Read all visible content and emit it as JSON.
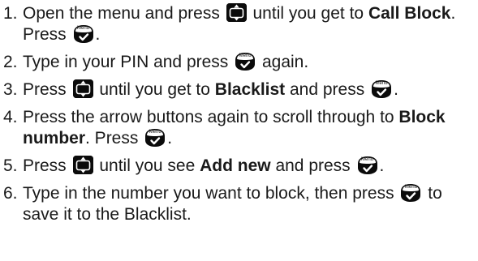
{
  "icons": {
    "nav": "up-down-arrow-key-icon",
    "menu": "menu-ok-key-icon"
  },
  "menu_key_label": "Menu",
  "colors": {
    "text": "#1a1a1a",
    "key_fill": "#0b0b0b",
    "key_symbol": "#ffffff"
  },
  "steps": [
    {
      "num": "1.",
      "t1": "Open the menu and press ",
      "t2": " until you get to ",
      "bold": "Call Block",
      "t3": ". Press ",
      "t4": "."
    },
    {
      "num": "2.",
      "t1": "Type in your PIN and press ",
      "t2": " again."
    },
    {
      "num": "3.",
      "t1": "Press ",
      "t2": " until you get to ",
      "bold": "Blacklist",
      "t3": " and press ",
      "t4": "."
    },
    {
      "num": "4.",
      "t1": "Press the arrow buttons again to scroll through to ",
      "bold": "Block number",
      "t2": ". Press ",
      "t3": "."
    },
    {
      "num": "5.",
      "t1": "Press ",
      "t2": " until you see ",
      "bold": "Add new",
      "t3": " and press ",
      "t4": "."
    },
    {
      "num": "6.",
      "t1": "Type in the number you want to block, then press ",
      "t2": " to save it to the Blacklist."
    }
  ]
}
